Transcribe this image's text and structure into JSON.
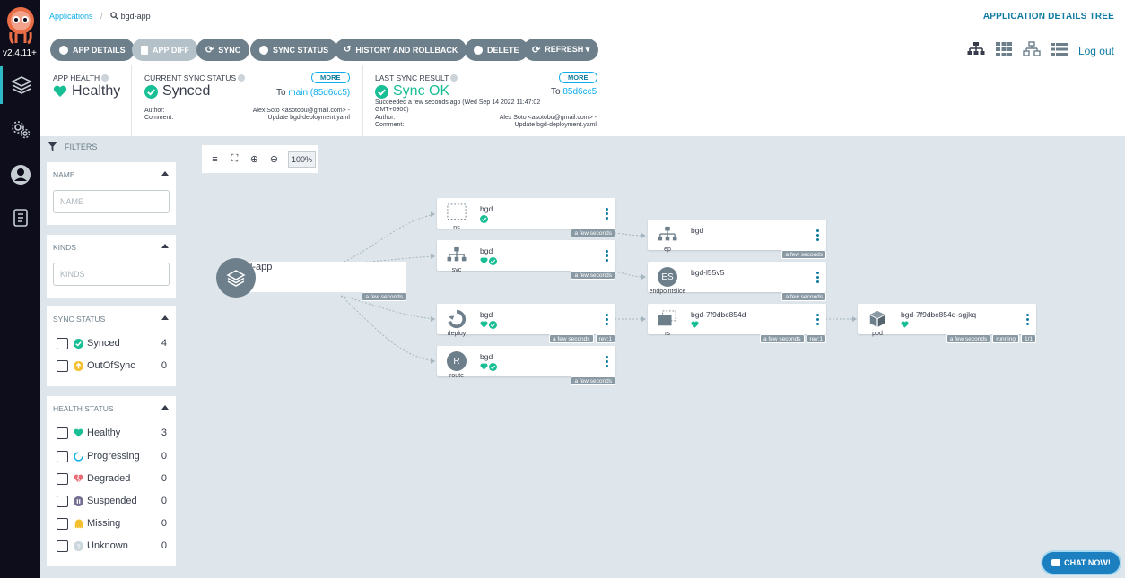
{
  "nav": {
    "version": "v2.4.11+"
  },
  "header": {
    "breadcrumb_link": "Applications",
    "breadcrumb_current": "bgd-app",
    "page_title": "APPLICATION DETAILS TREE",
    "logout": "Log out"
  },
  "toolbar": {
    "app_details": "APP DETAILS",
    "app_diff": "APP DIFF",
    "sync": "SYNC",
    "sync_status": "SYNC STATUS",
    "history": "HISTORY AND ROLLBACK",
    "delete": "DELETE",
    "refresh": "REFRESH ▾"
  },
  "status": {
    "app_health_label": "APP HEALTH",
    "app_health_value": "Healthy",
    "sync_label": "CURRENT SYNC STATUS",
    "sync_value": "Synced",
    "sync_to_prefix": "To",
    "sync_to_rev": "main (85d6cc5)",
    "more": "MORE",
    "author_label": "Author:",
    "comment_label": "Comment:",
    "author_value": "Alex Soto <asotobu@gmail.com> -",
    "comment_value": "Update bgd-deployment.yaml",
    "last_sync_label": "LAST SYNC RESULT",
    "last_sync_value": "Sync OK",
    "last_sync_to_prefix": "To",
    "last_sync_to_rev": "85d6cc5",
    "last_sync_time": "Succeeded a few seconds ago (Wed Sep 14 2022 11:47:02",
    "last_sync_tz": "GMT+0900)"
  },
  "filters": {
    "title": "FILTERS",
    "name_title": "NAME",
    "name_placeholder": "NAME",
    "kinds_title": "KINDS",
    "kinds_placeholder": "KINDS",
    "sync_title": "SYNC STATUS",
    "sync_items": [
      {
        "label": "Synced",
        "count": "4"
      },
      {
        "label": "OutOfSync",
        "count": "0"
      }
    ],
    "health_title": "HEALTH STATUS",
    "health_items": [
      {
        "label": "Healthy",
        "count": "3"
      },
      {
        "label": "Progressing",
        "count": "0"
      },
      {
        "label": "Degraded",
        "count": "0"
      },
      {
        "label": "Suspended",
        "count": "0"
      },
      {
        "label": "Missing",
        "count": "0"
      },
      {
        "label": "Unknown",
        "count": "0"
      }
    ]
  },
  "graph": {
    "zoom": "100%",
    "app": {
      "name": "bgd-app",
      "tag": "a few seconds"
    },
    "nodes": {
      "ns": {
        "name": "bgd",
        "kind": "ns",
        "tag": "a few seconds"
      },
      "svc": {
        "name": "bgd",
        "kind": "svc",
        "tag": "a few seconds"
      },
      "deploy": {
        "name": "bgd",
        "kind": "deploy",
        "tag": "a few seconds",
        "rev": "rev:1"
      },
      "route": {
        "name": "bgd",
        "kind": "route",
        "tag": "a few seconds",
        "letter": "R"
      },
      "ep": {
        "name": "bgd",
        "kind": "ep",
        "tag": "a few seconds"
      },
      "eps": {
        "name": "bgd-l55v5",
        "kind": "endpointslice",
        "tag": "a few seconds",
        "letter": "ES"
      },
      "rs": {
        "name": "bgd-7f9dbc854d",
        "kind": "rs",
        "tag": "a few seconds",
        "rev": "rev:1"
      },
      "pod": {
        "name": "bgd-7f9dbc854d-sgjkq",
        "kind": "pod",
        "tag": "a few seconds",
        "status": "running",
        "count": "1/1"
      }
    }
  },
  "chat": "CHAT NOW!",
  "colors": {
    "nav_bg": "#0e0d1b",
    "accent": "#0dadea",
    "healthy": "#18be94",
    "button": "#6d7f8b",
    "canvas": "#dee6eb"
  }
}
